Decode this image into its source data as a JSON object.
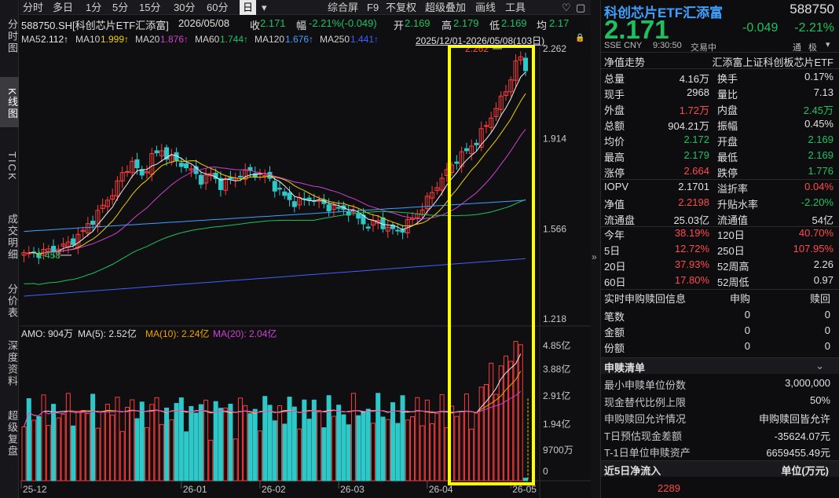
{
  "left_tabs": [
    "分时图",
    "K线图",
    "TICK",
    "成交明细",
    "分价表",
    "深度资料",
    "超级复盘"
  ],
  "topbar": {
    "tabs": [
      "分时",
      "多日",
      "1分",
      "5分",
      "15分",
      "30分",
      "60分",
      "日"
    ],
    "active": "日",
    "dropdown": "▾",
    "tools": [
      "综合屏",
      "F9",
      "不复权",
      "超级叠加",
      "画线",
      "工具"
    ],
    "fav": "♡",
    "more": "▢"
  },
  "info": {
    "code": "588750.SH[科创芯片ETF汇添富]",
    "date": "2026/05/08",
    "close_label": "收",
    "close": "2.171",
    "change_label": "幅",
    "change": "-2.21%(-0.049)",
    "open_label": "开",
    "open": "2.169",
    "high_label": "高",
    "high": "2.179",
    "low_label": "低",
    "low": "2.169",
    "avg_label": "均",
    "avg": "2.17"
  },
  "ma": {
    "items": [
      {
        "label": "MA5",
        "value": "2.112↑",
        "color": "#f0f0f0"
      },
      {
        "label": "MA10",
        "value": "1.999↑",
        "color": "#f0d000"
      },
      {
        "label": "MA20",
        "value": "1.876↑",
        "color": "#d040d0"
      },
      {
        "label": "MA60",
        "value": "1.744↑",
        "color": "#20c060"
      },
      {
        "label": "MA120",
        "value": "1.676↑",
        "color": "#40a0ff"
      },
      {
        "label": "MA250",
        "value": "1.441↑",
        "color": "#4060ff"
      }
    ],
    "range": "2025/12/01-2026/05/08(103日)",
    "lock": "🔒"
  },
  "amo": {
    "text": "AMO: 904万",
    "ma5": "MA(5): 2.52亿",
    "ma10": "MA(10): 2.24亿",
    "ma20": "MA(20): 2.04亿"
  },
  "chart_data": {
    "type": "candlestick",
    "price_ticks": [
      "2.262",
      "1.914",
      "1.566",
      "1.218"
    ],
    "volume_ticks": [
      "4.85亿",
      "3.88亿",
      "2.91亿",
      "1.94亿",
      "9700万",
      "0"
    ],
    "x_ticks": [
      "25-12",
      "26-01",
      "26-02",
      "26-03",
      "26-04",
      "26-05"
    ],
    "max_label": "2.262",
    "min_label": "1.458",
    "ylim": [
      1.218,
      2.262
    ],
    "highlight_box": true
  },
  "quote": {
    "name": "科创芯片ETF汇添富",
    "code": "588750",
    "price": "2.171",
    "change": "-0.049",
    "change_pct": "-2.21%",
    "exchange": "SSE CNY",
    "time": "9:30:50",
    "status": "交易中",
    "tong": "通",
    "ji": "极"
  },
  "detail_title": {
    "left": "净值走势",
    "right": "汇添富上证科创板芯片ETF"
  },
  "stats": [
    [
      "总量",
      "4.16万",
      "white",
      "换手",
      "0.17%",
      "white"
    ],
    [
      "现手",
      "2968",
      "white",
      "量比",
      "7.13",
      "white"
    ],
    [
      "外盘",
      "1.72万",
      "red",
      "内盘",
      "2.45万",
      "green"
    ],
    [
      "总额",
      "904.21万",
      "white",
      "振幅",
      "0.45%",
      "white"
    ],
    [
      "均价",
      "2.172",
      "green",
      "开盘",
      "2.169",
      "green"
    ],
    [
      "最高",
      "2.179",
      "green",
      "最低",
      "2.169",
      "green"
    ],
    [
      "涨停",
      "2.664",
      "red",
      "跌停",
      "1.776",
      "green"
    ]
  ],
  "stats2": [
    [
      "IOPV",
      "2.1701",
      "white",
      "溢折率",
      "0.04%",
      "red"
    ],
    [
      "净值",
      "2.2198",
      "red",
      "升贴水率",
      "-2.20%",
      "green"
    ],
    [
      "流通盘",
      "25.03亿",
      "white",
      "流通值",
      "54亿",
      "white"
    ]
  ],
  "stats3": [
    [
      "今年",
      "38.19%",
      "red",
      "120日",
      "40.70%",
      "red"
    ],
    [
      "5日",
      "12.72%",
      "red",
      "250日",
      "107.95%",
      "red"
    ],
    [
      "20日",
      "37.93%",
      "red",
      "52周高",
      "2.26",
      "white"
    ],
    [
      "60日",
      "17.80%",
      "red",
      "52周低",
      "0.97",
      "white"
    ]
  ],
  "sub_table": {
    "headers": [
      "实时申购赎回信息",
      "申购",
      "赎回"
    ],
    "rows": [
      [
        "笔数",
        "0",
        "0"
      ],
      [
        "金额",
        "0",
        "0"
      ],
      [
        "份额",
        "0",
        "0"
      ]
    ]
  },
  "creation": {
    "title": "申赎清单",
    "rows": [
      [
        "最小申赎单位份数",
        "3,000,000"
      ],
      [
        "现金替代比例上限",
        "50%"
      ],
      [
        "申购赎回允许情况",
        "申购赎回皆允许"
      ],
      [
        "T日预估现金差额",
        "-35624.07元"
      ],
      [
        "T-1日单位申赎资产",
        "6659455.49元"
      ]
    ]
  },
  "inflow": {
    "title": "近5日净流入",
    "unit": "单位(万元)",
    "value": "2289"
  },
  "collapse": "»"
}
